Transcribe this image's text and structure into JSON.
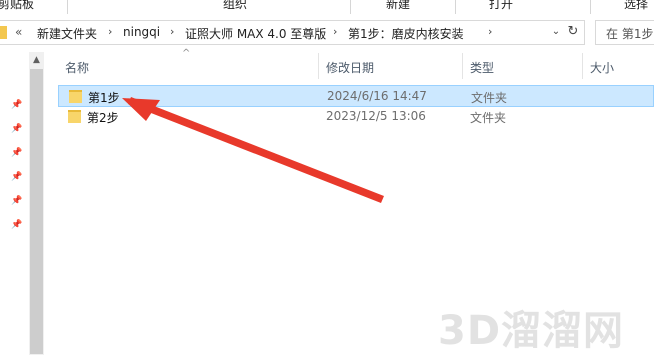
{
  "ribbon": {
    "groups": [
      "剪贴板",
      "组织",
      "新建",
      "打开",
      "选择"
    ]
  },
  "address": {
    "crumbs": [
      "新建文件夹",
      "ningqi",
      "证照大师 MAX 4.0 至尊版",
      "第1步：磨皮内核安装"
    ],
    "overflow_label": "«",
    "search_placeholder": "在 第1步"
  },
  "columns": {
    "name": "名称",
    "modified": "修改日期",
    "type": "类型",
    "size": "大小"
  },
  "rows": [
    {
      "name": "第1步",
      "modified": "2024/6/16 14:47",
      "type": "文件夹",
      "selected": true
    },
    {
      "name": "第2步",
      "modified": "2023/12/5 13:06",
      "type": "文件夹",
      "selected": false
    }
  ],
  "annotation": {
    "color": "#e8392b"
  },
  "watermark": "3D溜溜网",
  "colors": {
    "selected_bg": "#cce8ff",
    "selected_border": "#99d1ff"
  }
}
